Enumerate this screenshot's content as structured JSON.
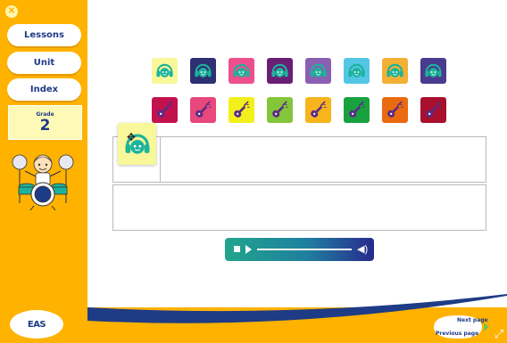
{
  "sidebar": {
    "close_icon": "close-icon",
    "lessons_label": "Lessons",
    "unit_label": "Unit",
    "index_label": "Index",
    "grade_label": "Grade",
    "grade_value": "2"
  },
  "tiles": {
    "row1": [
      {
        "bg": "#f8f79a",
        "icon": "headphones-icon"
      },
      {
        "bg": "#2f2f74",
        "icon": "headphones-icon"
      },
      {
        "bg": "#ee4f8d",
        "icon": "headphones-icon"
      },
      {
        "bg": "#6a1f74",
        "icon": "headphones-icon"
      },
      {
        "bg": "#8b60b2",
        "icon": "headphones-icon"
      },
      {
        "bg": "#53c6e6",
        "icon": "headphones-icon"
      },
      {
        "bg": "#f2b035",
        "icon": "headphones-icon"
      },
      {
        "bg": "#4a3a90",
        "icon": "headphones-icon"
      }
    ],
    "row2": [
      {
        "bg": "#c2124e",
        "icon": "guitar-icon"
      },
      {
        "bg": "#e8487c",
        "icon": "guitar-icon"
      },
      {
        "bg": "#f3ef1a",
        "icon": "guitar-icon"
      },
      {
        "bg": "#84c53a",
        "icon": "guitar-icon"
      },
      {
        "bg": "#f7b41b",
        "icon": "guitar-icon"
      },
      {
        "bg": "#18a23f",
        "icon": "guitar-icon"
      },
      {
        "bg": "#ea6a10",
        "icon": "guitar-icon"
      },
      {
        "bg": "#a8102d",
        "icon": "guitar-icon"
      }
    ]
  },
  "dragged_tile": {
    "bg": "#f8f79a",
    "icon": "headphones-icon"
  },
  "player": {
    "stop_icon": "stop-icon",
    "play_icon": "play-icon",
    "volume_icon": "volume-icon",
    "progress": 0
  },
  "footer": {
    "logo_text": "EAS",
    "next_page_label": "Next page",
    "previous_page_label": "Previous page",
    "fullscreen_icon": "fullscreen-icon"
  },
  "colors": {
    "brand_orange": "#ffb200",
    "navy": "#1e3b86",
    "headphone_teal": "#1bb39b",
    "guitar_purple": "#5a2b86"
  }
}
